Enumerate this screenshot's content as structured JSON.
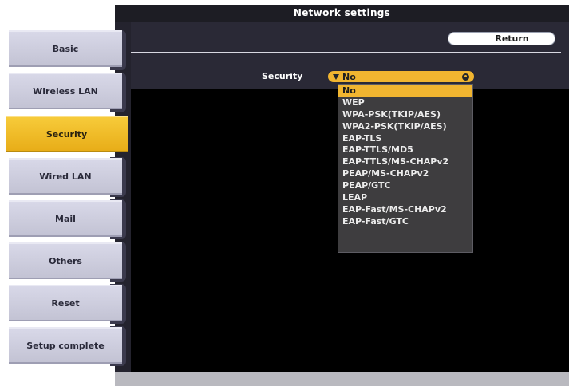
{
  "title": "Network settings",
  "sidebar": {
    "items": [
      {
        "label": "Basic"
      },
      {
        "label": "Wireless LAN"
      },
      {
        "label": "Security"
      },
      {
        "label": "Wired LAN"
      },
      {
        "label": "Mail"
      },
      {
        "label": "Others"
      },
      {
        "label": "Reset"
      },
      {
        "label": "Setup complete"
      }
    ],
    "active_label": "Security"
  },
  "main": {
    "return_label": "Return",
    "security_label": "Security",
    "security_value": "No",
    "options": [
      "No",
      "WEP",
      "WPA-PSK(TKIP/AES)",
      "WPA2-PSK(TKIP/AES)",
      "EAP-TLS",
      "EAP-TTLS/MD5",
      "EAP-TTLS/MS-CHAPv2",
      "PEAP/MS-CHAPv2",
      "PEAP/GTC",
      "LEAP",
      "EAP-Fast/MS-CHAPv2",
      "EAP-Fast/GTC"
    ],
    "selected_option": "No"
  },
  "colors": {
    "accent": "#f1b530",
    "background": "#000000",
    "panel": "#2a2936",
    "sidebar_button": "#c8c8d8"
  }
}
